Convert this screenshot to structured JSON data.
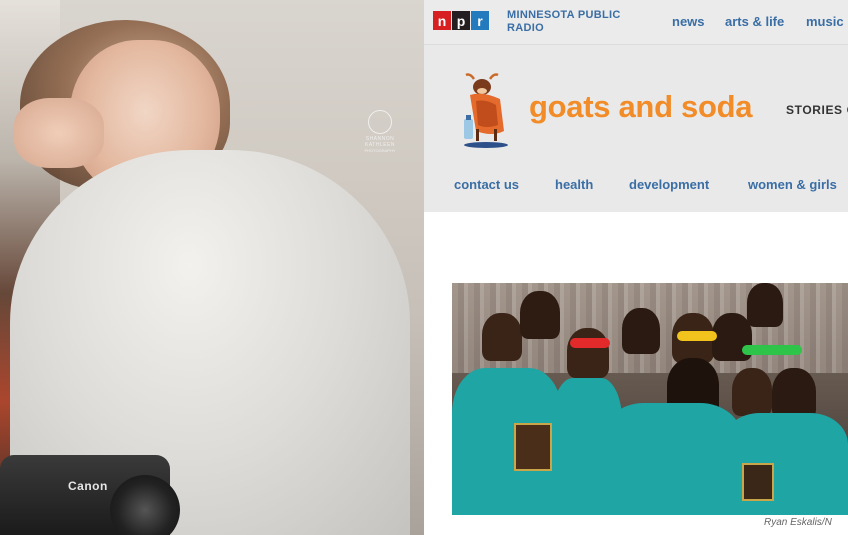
{
  "left_photo": {
    "camera_brand": "Canon",
    "watermark_line1": "SHANNON KATHLEEN",
    "watermark_line2": "PHOTOGRAPHY"
  },
  "npr": {
    "logo": {
      "n": "n",
      "p": "p",
      "r": "r"
    },
    "station_name": "MINNESOTA PUBLIC RADIO",
    "top_nav": [
      "news",
      "arts & life",
      "music"
    ]
  },
  "blog": {
    "title": "goats and soda",
    "tagline": "STORIES O",
    "nav": [
      "contact us",
      "health",
      "development",
      "women & girls"
    ]
  },
  "article": {
    "photo_credit": "Ryan Eskalis/N"
  },
  "colors": {
    "npr_blue": "#3a6ea5",
    "goats_orange": "#f28c28",
    "teal_shirt": "#1fa5a4"
  }
}
